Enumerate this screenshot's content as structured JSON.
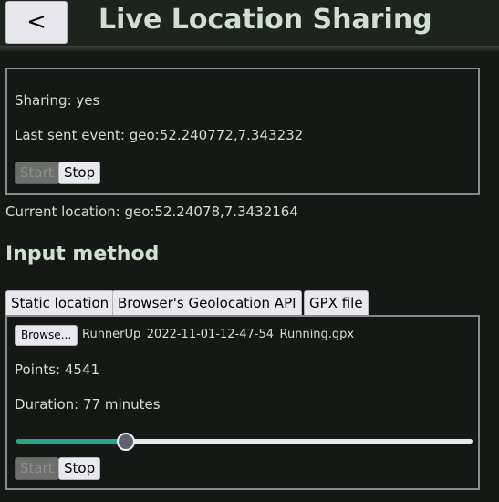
{
  "header": {
    "back_label": "<",
    "title": "Live Location Sharing"
  },
  "status": {
    "sharing": "Sharing: yes",
    "last_sent_event": "Last sent event: geo:52.240772,7.343232",
    "start_label": "Start",
    "stop_label": "Stop"
  },
  "current_location": "Current location: geo:52.24078,7.3432164",
  "input_method": {
    "title": "Input method",
    "tabs": [
      {
        "label": "Static location"
      },
      {
        "label": "Browser's Geolocation API"
      },
      {
        "label": "GPX file",
        "active": true
      }
    ],
    "gpx": {
      "browse_label": "Browse...",
      "filename": "RunnerUp_2022-11-01-12-47-54_Running.gpx",
      "points": "Points: 4541",
      "duration": "Duration: 77 minutes",
      "slider_fraction": 0.24,
      "start_label": "Start",
      "stop_label": "Stop"
    }
  },
  "colors": {
    "background": "#151915",
    "header": "#1d241d",
    "title": "#cfe0cf",
    "slider_fill": "#2aa58a"
  }
}
